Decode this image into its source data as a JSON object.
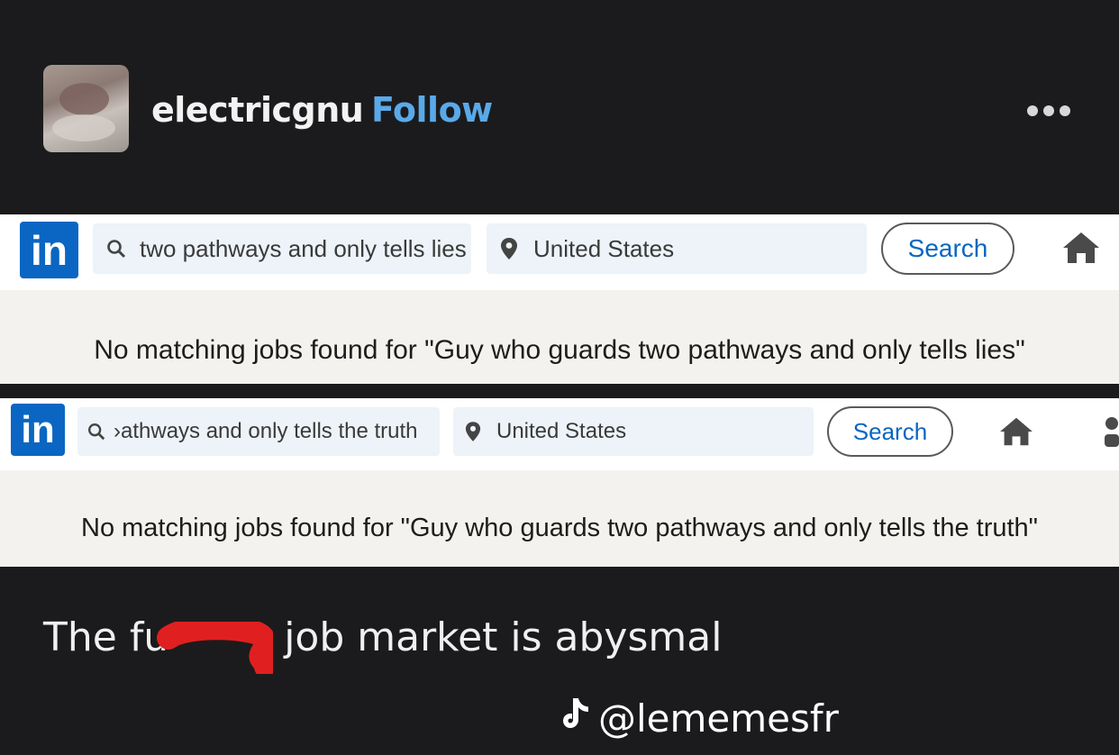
{
  "post": {
    "username": "electricgnu",
    "follow_label": "Follow",
    "caption_start": "The fu",
    "caption_end": "job market is abysmal"
  },
  "screenshots": [
    {
      "logo": "in",
      "search_query": "two pathways and only tells lies",
      "location": "United States",
      "search_label": "Search",
      "message": "No matching jobs found for \"Guy who guards two pathways and only tells lies\""
    },
    {
      "logo": "in",
      "search_query": "›athways and only tells the truth",
      "location": "United States",
      "search_label": "Search",
      "message": "No matching jobs found for \"Guy who guards two pathways and only tells the truth\""
    }
  ],
  "watermark": {
    "handle": "@lememesfr",
    "icon": "tiktok-icon"
  },
  "colors": {
    "background": "#1b1b1d",
    "follow": "#5aa9e8",
    "linkedin_blue": "#0a66c2",
    "redaction": "#e02020"
  }
}
